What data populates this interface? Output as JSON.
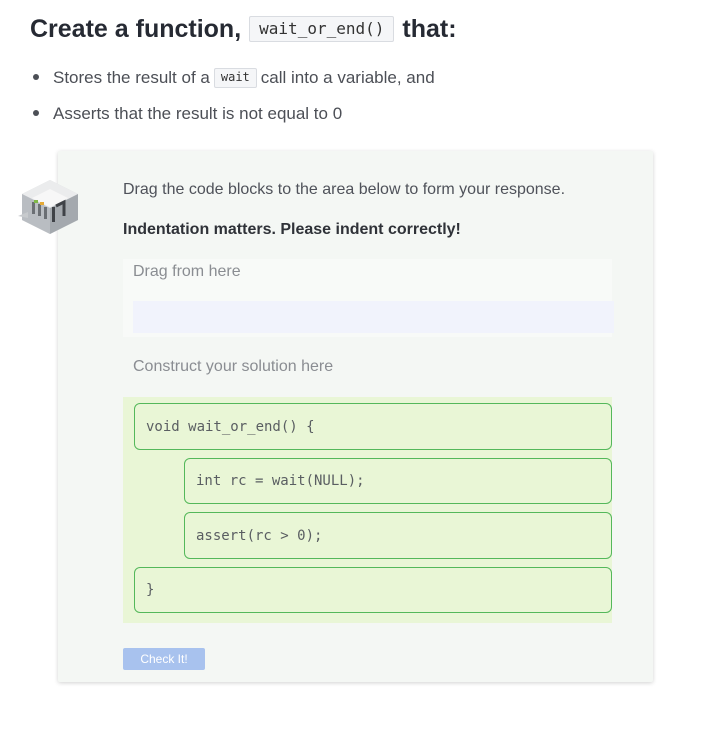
{
  "heading": {
    "prefix": "Create a function,",
    "function_name": "wait_or_end()",
    "suffix": "that:"
  },
  "bullets": [
    {
      "before": "Stores the result of a",
      "code": "wait",
      "after": "call into a variable, and"
    },
    {
      "text": "Asserts that the result is not equal to 0"
    }
  ],
  "widget": {
    "icon": "parsons-blocks-icon",
    "instruction": "Drag the code blocks to the area below to form your response.",
    "indentation_note": "Indentation matters. Please indent correctly!",
    "source_label": "Drag from here",
    "target_label": "Construct your solution here",
    "blocks": [
      {
        "code": "void wait_or_end() {",
        "indent": 0
      },
      {
        "code": "int rc = wait(NULL);",
        "indent": 1
      },
      {
        "code": "assert(rc > 0);",
        "indent": 1
      },
      {
        "code": "}",
        "indent": 0
      }
    ],
    "check_button": "Check It!"
  },
  "colors": {
    "block_border": "#54b85a",
    "block_fill": "#e9f6d6",
    "button": "#a8c2ee"
  }
}
